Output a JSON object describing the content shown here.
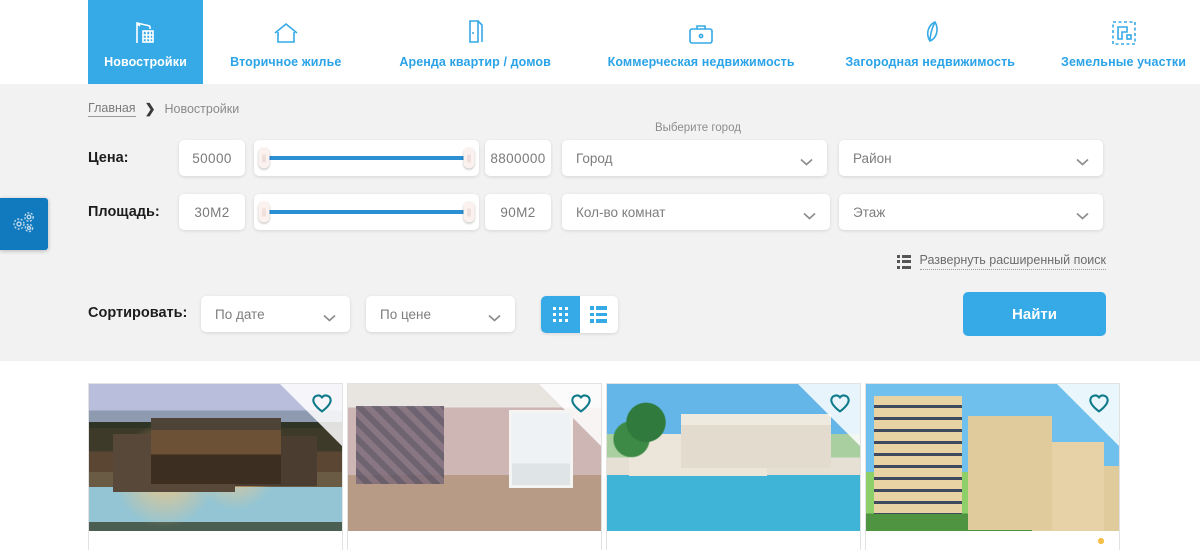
{
  "nav": {
    "items": [
      {
        "label": "Новостройки",
        "icon": "crane-icon",
        "active": true
      },
      {
        "label": "Вторичное жилье",
        "icon": "house-icon",
        "active": false
      },
      {
        "label": "Аренда квартир / домов",
        "icon": "door-icon",
        "active": false
      },
      {
        "label": "Коммерческая недвижимость",
        "icon": "briefcase-icon",
        "active": false
      },
      {
        "label": "Загородная недвижимость",
        "icon": "leaf-icon",
        "active": false
      },
      {
        "label": "Земельные участки",
        "icon": "land-plot-icon",
        "active": false
      }
    ],
    "active_bg": "#35aae6",
    "link_color": "#2aa3e8"
  },
  "breadcrumb": {
    "home": "Главная",
    "separator": "❯",
    "current": "Новостройки"
  },
  "filters": {
    "price": {
      "label": "Цена:",
      "min_value": "50000",
      "max_value": "8800000"
    },
    "area": {
      "label": "Площадь:",
      "min_value": "30М2",
      "max_value": "90М2"
    },
    "city_hint": "Выберите город",
    "city": {
      "placeholder": "Город"
    },
    "district": {
      "placeholder": "Район"
    },
    "rooms": {
      "placeholder": "Кол-во комнат"
    },
    "floor": {
      "placeholder": "Этаж"
    },
    "advanced_link": "Развернуть расширенный поиск",
    "slider_fill_color": "#2b8fd4"
  },
  "sort": {
    "label": "Сортировать:",
    "by_date": "По дате",
    "by_price": "По цене",
    "view_grid": "grid-view-icon",
    "view_list": "list-view-icon",
    "active_view": "grid"
  },
  "search_button": {
    "label": "Найти",
    "color": "#35aae6"
  },
  "side_tab": {
    "icon": "gears-icon",
    "color": "#1179bd"
  },
  "results": {
    "cards": [
      {
        "image": "modern-house-with-pool",
        "favorite_icon": "heart-icon"
      },
      {
        "image": "empty-renovated-room",
        "favorite_icon": "heart-icon"
      },
      {
        "image": "villa-with-palm-trees-and-pool",
        "favorite_icon": "heart-icon"
      },
      {
        "image": "high-rise-apartment-towers",
        "favorite_icon": "heart-icon"
      }
    ]
  }
}
